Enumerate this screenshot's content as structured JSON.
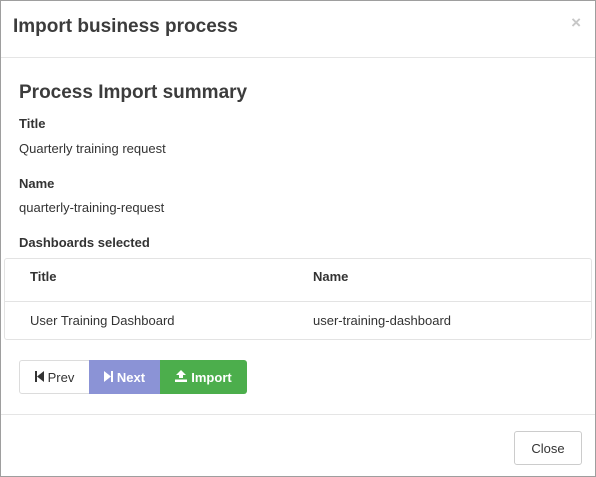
{
  "modal": {
    "title": "Import business process",
    "close_icon": "close-icon"
  },
  "summary": {
    "heading": "Process Import summary",
    "title_label": "Title",
    "title_value": "Quarterly training request",
    "name_label": "Name",
    "name_value": "quarterly-training-request",
    "dashboards_label": "Dashboards selected"
  },
  "dashboards_table": {
    "columns": [
      "Title",
      "Name"
    ],
    "rows": [
      {
        "title": "User Training Dashboard",
        "name": "user-training-dashboard"
      }
    ]
  },
  "wizard_buttons": {
    "prev_label": "Prev",
    "next_label": "Next",
    "import_label": "Import",
    "prev_icon": "step-backward-icon",
    "next_icon": "step-forward-icon",
    "import_icon": "upload-icon"
  },
  "footer": {
    "close_label": "Close"
  },
  "colors": {
    "next_bg": "#8b93d6",
    "import_bg": "#4cae4c"
  }
}
